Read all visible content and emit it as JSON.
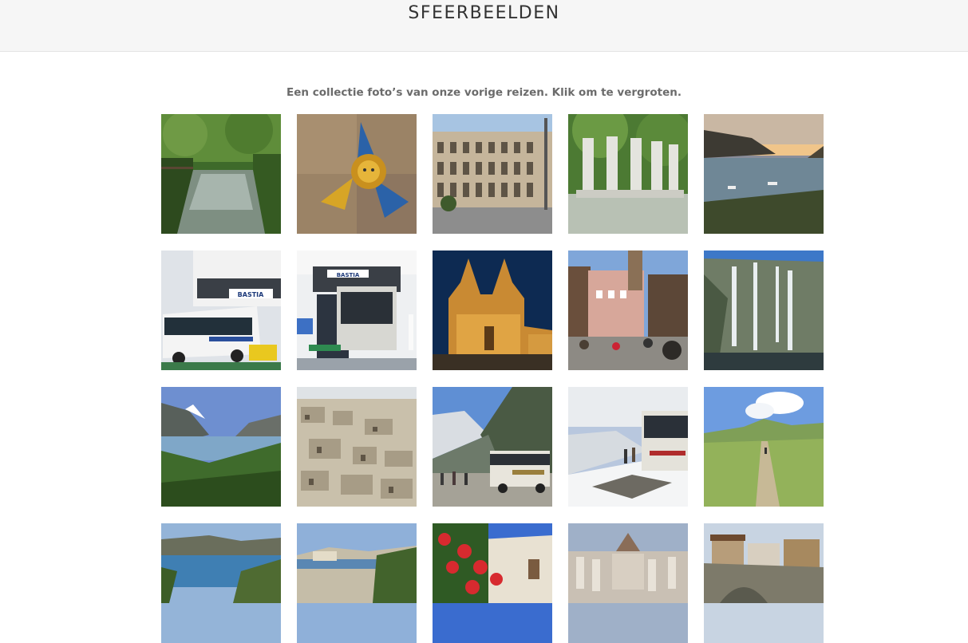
{
  "page": {
    "title": "SFEERBEELDEN",
    "intro": "Een collectie foto’s van onze vorige reizen. Klik om te vergroten.",
    "bus_label_1": "BASTIA",
    "bus_label_2": "BASTIA"
  },
  "gallery": {
    "rows": 4,
    "columns": 5,
    "photos": [
      "gorge-river",
      "trinacria-ceramic",
      "colosseum",
      "statues-villa",
      "harbor-sunset",
      "ferry-bus-1",
      "ferry-bus-2",
      "cathedral-night",
      "town-square",
      "waterfalls-fjord",
      "fjord-valley",
      "cave-town",
      "glacier-bus",
      "snow-bus",
      "grass-path",
      "coast-cliffs",
      "cliff-town",
      "red-flowers",
      "parliament",
      "stone-bridge-town"
    ]
  }
}
